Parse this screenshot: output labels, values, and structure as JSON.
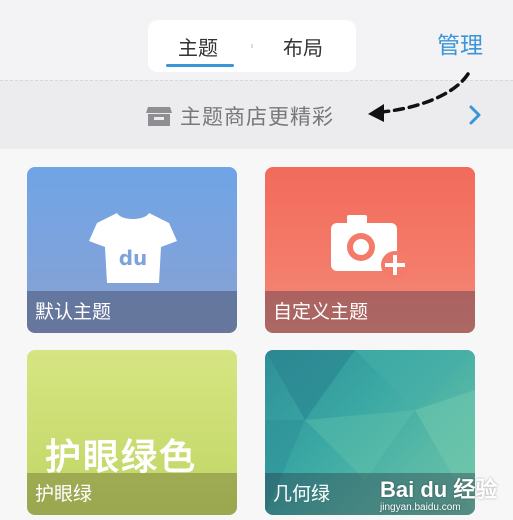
{
  "header": {
    "tabs": [
      {
        "label": "主题",
        "active": true
      },
      {
        "label": "布局",
        "active": false
      }
    ],
    "manage_label": "管理"
  },
  "banner": {
    "text": "主题商店更精彩",
    "icon": "store-icon"
  },
  "themes": [
    {
      "label": "默认主题",
      "icon": "tshirt-du-icon",
      "icon_text": "du"
    },
    {
      "label": "自定义主题",
      "icon": "camera-plus-icon"
    },
    {
      "label": "护眼绿",
      "big_text": "护眼绿色"
    },
    {
      "label": "几何绿"
    }
  ],
  "watermark": {
    "logo_text": "Bai du 经验",
    "sub_text": "jingyan.baidu.com"
  },
  "colors": {
    "accent": "#3b95d9",
    "default_card": "#7ea3dc",
    "custom_card": "#f47a69",
    "eye_card": "#c9dc70",
    "geo_card": "#3aa8a4"
  }
}
